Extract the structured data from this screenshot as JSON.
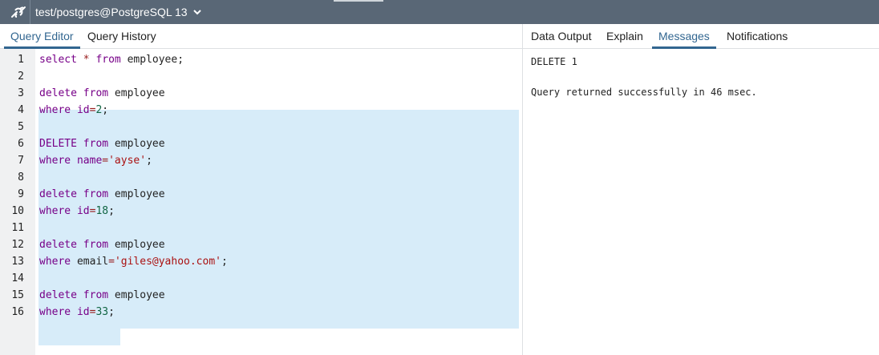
{
  "toolbar": {
    "connection_title": "test/postgres@PostgreSQL 13"
  },
  "left_tabs": [
    {
      "label": "Query Editor",
      "active": true
    },
    {
      "label": "Query History",
      "active": false
    }
  ],
  "right_tabs": [
    {
      "label": "Data Output",
      "active": false
    },
    {
      "label": "Explain",
      "active": false
    },
    {
      "label": "Messages",
      "active": true
    },
    {
      "label": "Notifications",
      "active": false
    }
  ],
  "editor": {
    "line_numbers": [
      "1",
      "2",
      "3",
      "4",
      "5",
      "6",
      "7",
      "8",
      "9",
      "10",
      "11",
      "12",
      "13",
      "14",
      "15",
      "16"
    ],
    "lines": [
      [
        {
          "t": "select",
          "c": "kw"
        },
        {
          "t": " "
        },
        {
          "t": "*",
          "c": "op"
        },
        {
          "t": " "
        },
        {
          "t": "from",
          "c": "kw"
        },
        {
          "t": " employee;"
        }
      ],
      [],
      [
        {
          "t": "delete",
          "c": "kw"
        },
        {
          "t": " "
        },
        {
          "t": "from",
          "c": "kw"
        },
        {
          "t": " employee"
        }
      ],
      [
        {
          "t": "where",
          "c": "kw"
        },
        {
          "t": " "
        },
        {
          "t": "id",
          "c": "kw"
        },
        {
          "t": "=",
          "c": "op"
        },
        {
          "t": "2",
          "c": "num"
        },
        {
          "t": ";"
        }
      ],
      [],
      [
        {
          "t": "DELETE",
          "c": "kw"
        },
        {
          "t": " "
        },
        {
          "t": "from",
          "c": "kw"
        },
        {
          "t": " employee"
        }
      ],
      [
        {
          "t": "where",
          "c": "kw"
        },
        {
          "t": " "
        },
        {
          "t": "name",
          "c": "kw"
        },
        {
          "t": "=",
          "c": "op"
        },
        {
          "t": "'ayse'",
          "c": "str"
        },
        {
          "t": ";"
        }
      ],
      [],
      [
        {
          "t": "delete",
          "c": "kw"
        },
        {
          "t": " "
        },
        {
          "t": "from",
          "c": "kw"
        },
        {
          "t": " employee"
        }
      ],
      [
        {
          "t": "where",
          "c": "kw"
        },
        {
          "t": " "
        },
        {
          "t": "id",
          "c": "kw"
        },
        {
          "t": "=",
          "c": "op"
        },
        {
          "t": "18",
          "c": "num"
        },
        {
          "t": ";"
        }
      ],
      [],
      [
        {
          "t": "delete",
          "c": "kw"
        },
        {
          "t": " "
        },
        {
          "t": "from",
          "c": "kw"
        },
        {
          "t": " employee"
        }
      ],
      [
        {
          "t": "where",
          "c": "kw"
        },
        {
          "t": " email"
        },
        {
          "t": "=",
          "c": "op"
        },
        {
          "t": "'giles@yahoo.com'",
          "c": "str"
        },
        {
          "t": ";"
        }
      ],
      [],
      [
        {
          "t": "delete",
          "c": "kw"
        },
        {
          "t": " "
        },
        {
          "t": "from",
          "c": "kw"
        },
        {
          "t": " employee"
        }
      ],
      [
        {
          "t": "where",
          "c": "kw"
        },
        {
          "t": " "
        },
        {
          "t": "id",
          "c": "kw"
        },
        {
          "t": "=",
          "c": "op"
        },
        {
          "t": "33",
          "c": "num"
        },
        {
          "t": ";"
        }
      ]
    ]
  },
  "messages": {
    "status": "DELETE 1",
    "result": "Query returned successfully in 46 msec."
  },
  "colors": {
    "toolbar_bg": "#596776",
    "active_tab": "#326690",
    "selection": "#d7ecf9",
    "keyword": "#770088",
    "number": "#116644",
    "string": "#aa1111"
  }
}
